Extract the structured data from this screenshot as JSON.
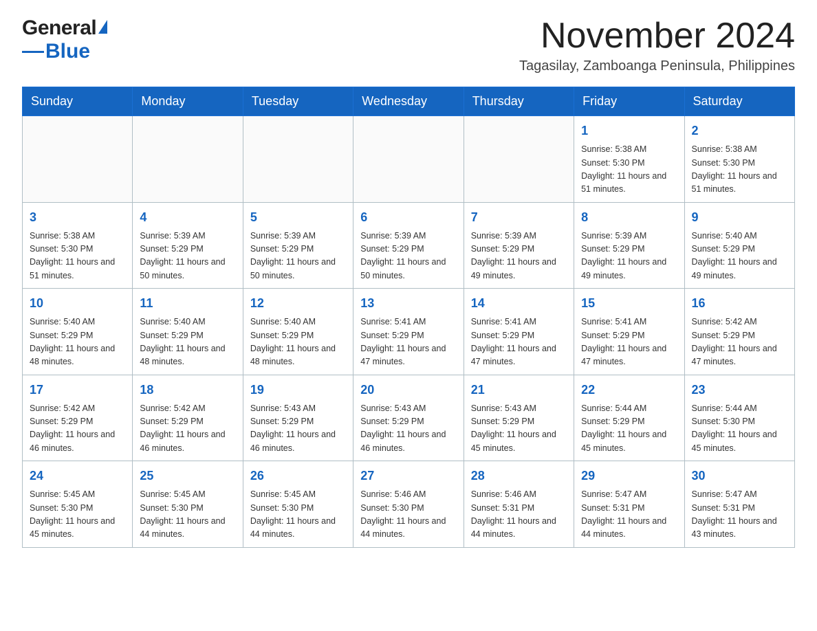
{
  "logo": {
    "text_general": "General",
    "text_blue": "Blue",
    "triangle_char": "▲"
  },
  "header": {
    "month_title": "November 2024",
    "location": "Tagasilay, Zamboanga Peninsula, Philippines"
  },
  "days_of_week": [
    "Sunday",
    "Monday",
    "Tuesday",
    "Wednesday",
    "Thursday",
    "Friday",
    "Saturday"
  ],
  "weeks": [
    {
      "days": [
        {
          "date": "",
          "sunrise": "",
          "sunset": "",
          "daylight": ""
        },
        {
          "date": "",
          "sunrise": "",
          "sunset": "",
          "daylight": ""
        },
        {
          "date": "",
          "sunrise": "",
          "sunset": "",
          "daylight": ""
        },
        {
          "date": "",
          "sunrise": "",
          "sunset": "",
          "daylight": ""
        },
        {
          "date": "",
          "sunrise": "",
          "sunset": "",
          "daylight": ""
        },
        {
          "date": "1",
          "sunrise": "Sunrise: 5:38 AM",
          "sunset": "Sunset: 5:30 PM",
          "daylight": "Daylight: 11 hours and 51 minutes."
        },
        {
          "date": "2",
          "sunrise": "Sunrise: 5:38 AM",
          "sunset": "Sunset: 5:30 PM",
          "daylight": "Daylight: 11 hours and 51 minutes."
        }
      ]
    },
    {
      "days": [
        {
          "date": "3",
          "sunrise": "Sunrise: 5:38 AM",
          "sunset": "Sunset: 5:30 PM",
          "daylight": "Daylight: 11 hours and 51 minutes."
        },
        {
          "date": "4",
          "sunrise": "Sunrise: 5:39 AM",
          "sunset": "Sunset: 5:29 PM",
          "daylight": "Daylight: 11 hours and 50 minutes."
        },
        {
          "date": "5",
          "sunrise": "Sunrise: 5:39 AM",
          "sunset": "Sunset: 5:29 PM",
          "daylight": "Daylight: 11 hours and 50 minutes."
        },
        {
          "date": "6",
          "sunrise": "Sunrise: 5:39 AM",
          "sunset": "Sunset: 5:29 PM",
          "daylight": "Daylight: 11 hours and 50 minutes."
        },
        {
          "date": "7",
          "sunrise": "Sunrise: 5:39 AM",
          "sunset": "Sunset: 5:29 PM",
          "daylight": "Daylight: 11 hours and 49 minutes."
        },
        {
          "date": "8",
          "sunrise": "Sunrise: 5:39 AM",
          "sunset": "Sunset: 5:29 PM",
          "daylight": "Daylight: 11 hours and 49 minutes."
        },
        {
          "date": "9",
          "sunrise": "Sunrise: 5:40 AM",
          "sunset": "Sunset: 5:29 PM",
          "daylight": "Daylight: 11 hours and 49 minutes."
        }
      ]
    },
    {
      "days": [
        {
          "date": "10",
          "sunrise": "Sunrise: 5:40 AM",
          "sunset": "Sunset: 5:29 PM",
          "daylight": "Daylight: 11 hours and 48 minutes."
        },
        {
          "date": "11",
          "sunrise": "Sunrise: 5:40 AM",
          "sunset": "Sunset: 5:29 PM",
          "daylight": "Daylight: 11 hours and 48 minutes."
        },
        {
          "date": "12",
          "sunrise": "Sunrise: 5:40 AM",
          "sunset": "Sunset: 5:29 PM",
          "daylight": "Daylight: 11 hours and 48 minutes."
        },
        {
          "date": "13",
          "sunrise": "Sunrise: 5:41 AM",
          "sunset": "Sunset: 5:29 PM",
          "daylight": "Daylight: 11 hours and 47 minutes."
        },
        {
          "date": "14",
          "sunrise": "Sunrise: 5:41 AM",
          "sunset": "Sunset: 5:29 PM",
          "daylight": "Daylight: 11 hours and 47 minutes."
        },
        {
          "date": "15",
          "sunrise": "Sunrise: 5:41 AM",
          "sunset": "Sunset: 5:29 PM",
          "daylight": "Daylight: 11 hours and 47 minutes."
        },
        {
          "date": "16",
          "sunrise": "Sunrise: 5:42 AM",
          "sunset": "Sunset: 5:29 PM",
          "daylight": "Daylight: 11 hours and 47 minutes."
        }
      ]
    },
    {
      "days": [
        {
          "date": "17",
          "sunrise": "Sunrise: 5:42 AM",
          "sunset": "Sunset: 5:29 PM",
          "daylight": "Daylight: 11 hours and 46 minutes."
        },
        {
          "date": "18",
          "sunrise": "Sunrise: 5:42 AM",
          "sunset": "Sunset: 5:29 PM",
          "daylight": "Daylight: 11 hours and 46 minutes."
        },
        {
          "date": "19",
          "sunrise": "Sunrise: 5:43 AM",
          "sunset": "Sunset: 5:29 PM",
          "daylight": "Daylight: 11 hours and 46 minutes."
        },
        {
          "date": "20",
          "sunrise": "Sunrise: 5:43 AM",
          "sunset": "Sunset: 5:29 PM",
          "daylight": "Daylight: 11 hours and 46 minutes."
        },
        {
          "date": "21",
          "sunrise": "Sunrise: 5:43 AM",
          "sunset": "Sunset: 5:29 PM",
          "daylight": "Daylight: 11 hours and 45 minutes."
        },
        {
          "date": "22",
          "sunrise": "Sunrise: 5:44 AM",
          "sunset": "Sunset: 5:29 PM",
          "daylight": "Daylight: 11 hours and 45 minutes."
        },
        {
          "date": "23",
          "sunrise": "Sunrise: 5:44 AM",
          "sunset": "Sunset: 5:30 PM",
          "daylight": "Daylight: 11 hours and 45 minutes."
        }
      ]
    },
    {
      "days": [
        {
          "date": "24",
          "sunrise": "Sunrise: 5:45 AM",
          "sunset": "Sunset: 5:30 PM",
          "daylight": "Daylight: 11 hours and 45 minutes."
        },
        {
          "date": "25",
          "sunrise": "Sunrise: 5:45 AM",
          "sunset": "Sunset: 5:30 PM",
          "daylight": "Daylight: 11 hours and 44 minutes."
        },
        {
          "date": "26",
          "sunrise": "Sunrise: 5:45 AM",
          "sunset": "Sunset: 5:30 PM",
          "daylight": "Daylight: 11 hours and 44 minutes."
        },
        {
          "date": "27",
          "sunrise": "Sunrise: 5:46 AM",
          "sunset": "Sunset: 5:30 PM",
          "daylight": "Daylight: 11 hours and 44 minutes."
        },
        {
          "date": "28",
          "sunrise": "Sunrise: 5:46 AM",
          "sunset": "Sunset: 5:31 PM",
          "daylight": "Daylight: 11 hours and 44 minutes."
        },
        {
          "date": "29",
          "sunrise": "Sunrise: 5:47 AM",
          "sunset": "Sunset: 5:31 PM",
          "daylight": "Daylight: 11 hours and 44 minutes."
        },
        {
          "date": "30",
          "sunrise": "Sunrise: 5:47 AM",
          "sunset": "Sunset: 5:31 PM",
          "daylight": "Daylight: 11 hours and 43 minutes."
        }
      ]
    }
  ]
}
